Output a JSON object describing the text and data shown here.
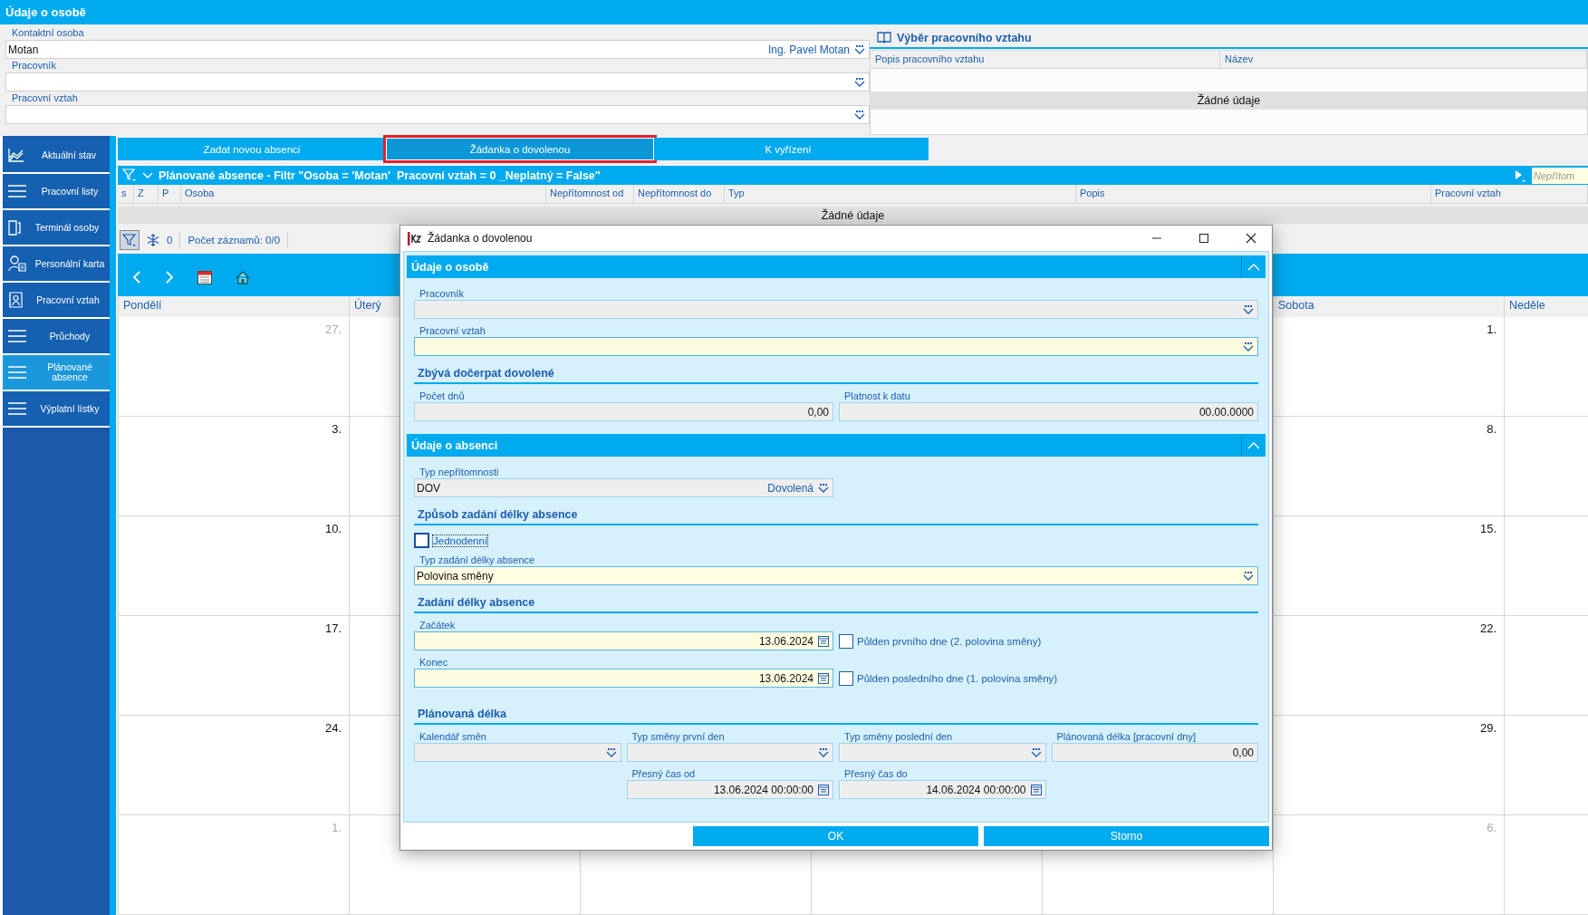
{
  "header": {
    "title": "Údaje o osobě"
  },
  "person_form": {
    "fields": [
      {
        "label": "Kontaktní osoba",
        "value": "Motan",
        "display": "Ing. Pavel Motan"
      },
      {
        "label": "Pracovník"
      },
      {
        "label": "Pracovní vztah"
      }
    ]
  },
  "relation_picker": {
    "title": "Výběr pracovního vztahu",
    "columns": [
      "Popis pracovního vztahu",
      "Název"
    ],
    "empty_text": "Žádné údaje"
  },
  "sidebar": {
    "items": [
      {
        "label": "Aktuální stav",
        "selected": false
      },
      {
        "label": "Pracovní listy",
        "selected": false
      },
      {
        "label": "Terminál osoby",
        "selected": false
      },
      {
        "label": "Personální karta",
        "selected": false
      },
      {
        "label": "Pracovní vztah",
        "selected": false
      },
      {
        "label": "Průchody",
        "selected": false
      },
      {
        "label": "Plánované absence",
        "selected": true
      },
      {
        "label": "Výplatní lístky",
        "selected": false
      }
    ]
  },
  "tabs": [
    {
      "label": "Zadat novou absenci",
      "selected": false,
      "highlighted": false
    },
    {
      "label": "Žádanka o dovolenou",
      "selected": true,
      "highlighted": true
    },
    {
      "label": "K vyřízení",
      "selected": false,
      "highlighted": false
    }
  ],
  "absence_list": {
    "title": "Plánované absence - Filtr \"Osoba = 'Motan'  Pracovní vztah = 0 _Neplatný = False\"",
    "search_placeholder": "Nepřítom",
    "columns": [
      "s",
      "Z",
      "P",
      "Osoba",
      "Nepřítomnost od",
      "Nepřítomnost do",
      "Typ",
      "Popis",
      "Pracovní vztah"
    ],
    "empty_text": "Žádné údaje",
    "filter_count": "0",
    "records": "Počet záznamů: 0/0"
  },
  "calendar": {
    "days": {
      "monday": "Pondělí",
      "tuesday": "Úterý",
      "saturday": "Sobota",
      "sunday": "Neděle"
    },
    "weeks": [
      {
        "monday": {
          "day": "27.",
          "muted": true
        },
        "saturday": {
          "day": "1.",
          "muted": false
        }
      },
      {
        "monday": {
          "day": "3.",
          "muted": false
        },
        "saturday": {
          "day": "8.",
          "muted": false
        }
      },
      {
        "monday": {
          "day": "10.",
          "muted": false
        },
        "saturday": {
          "day": "15.",
          "muted": false
        }
      },
      {
        "monday": {
          "day": "17.",
          "muted": false
        },
        "saturday": {
          "day": "22.",
          "muted": false
        }
      },
      {
        "monday": {
          "day": "24.",
          "muted": false
        },
        "saturday": {
          "day": "29.",
          "muted": false
        }
      },
      {
        "monday": {
          "day": "1.",
          "muted": true
        },
        "saturday": {
          "day": "6.",
          "muted": true
        }
      }
    ]
  },
  "dialog": {
    "title": "Žádanka o dovolenou",
    "person_section": {
      "title": "Údaje o osobě",
      "expanded": true,
      "employee": {
        "label": "Pracovník",
        "kind": "readonly"
      },
      "relation": {
        "label": "Pracovní vztah",
        "kind": "required"
      },
      "remaining": {
        "title": "Zbývá dočerpat dovolené",
        "days": {
          "label": "Počet dnů",
          "value": "0,00",
          "kind": "readonly"
        },
        "valid_to": {
          "label": "Platnost k datu",
          "value": "00.00.0000",
          "kind": "readonly"
        }
      }
    },
    "absence_section": {
      "title": "Údaje o absenci",
      "expanded": true,
      "absence_type": {
        "label": "Typ nepřítomnosti",
        "value": "DOV",
        "display": "Dovolená",
        "kind": "readonly"
      },
      "entry_mode": {
        "title": "Způsob zadání délky absence",
        "single_day": {
          "label": "Jednodenní",
          "checked": false
        },
        "length_type": {
          "label": "Typ zadání délky absence",
          "value": "Polovina směny",
          "kind": "required"
        }
      },
      "length": {
        "title": "Zadání délky absence",
        "start": {
          "label": "Začátek",
          "value": "13.06.2024",
          "kind": "required",
          "half_day": {
            "label": "Půlden prvního dne (2. polovina směny)",
            "checked": false
          }
        },
        "end": {
          "label": "Konec",
          "value": "13.06.2024",
          "kind": "required",
          "half_day": {
            "label": "Půlden posledního dne  (1. polovina směny)",
            "checked": false
          }
        }
      },
      "planned": {
        "title": "Plánovaná délka",
        "shift_calendar": {
          "label": "Kalendář směn",
          "kind": "readonly"
        },
        "first_shift": {
          "label": "Typ směny první den",
          "kind": "readonly"
        },
        "last_shift": {
          "label": "Typ směny poslední den",
          "kind": "readonly"
        },
        "planned_days": {
          "label": "Plánovaná délka [pracovní dny]",
          "value": "0,00",
          "kind": "readonly"
        },
        "time_from": {
          "label": "Přesný čas od",
          "value": "13.06.2024 00:00:00",
          "kind": "readonly"
        },
        "time_to": {
          "label": "Přesný čas do",
          "value": "14.06.2024 00:00:00",
          "kind": "readonly"
        }
      }
    },
    "buttons": [
      "OK",
      "Storno"
    ]
  }
}
